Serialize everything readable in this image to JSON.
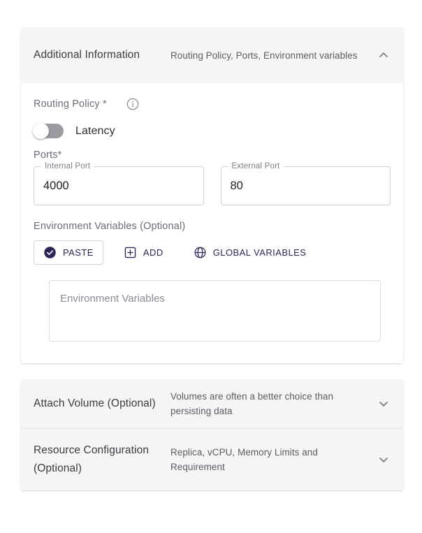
{
  "panels": {
    "additional": {
      "title": "Additional Information",
      "subtitle": "Routing Policy, Ports, Environment variables",
      "expand_icon": "chevron-up-icon"
    },
    "attach_volume": {
      "title": "Attach Volume (Optional)",
      "subtitle": "Volumes are often a better choice than persisting data",
      "expand_icon": "chevron-down-icon"
    },
    "resource_configuration": {
      "title": "Resource Configuration (Optional)",
      "subtitle": "Replica, vCPU, Memory Limits and Requirement",
      "expand_icon": "chevron-down-icon"
    }
  },
  "routing_policy": {
    "label": "Routing Policy *",
    "info_icon": "info-circle-icon",
    "switch": {
      "label": "Latency",
      "state": "off"
    }
  },
  "ports": {
    "label": "Ports*",
    "internal": {
      "label": "Internal Port",
      "value": "4000",
      "placeholder": "Internal Port"
    },
    "external": {
      "label": "External Port",
      "value": "80",
      "placeholder": "External Port"
    }
  },
  "environment_variables": {
    "label": "Environment Variables (Optional)",
    "buttons": [
      {
        "label": "PASTE",
        "icon": "check-circle-filled-icon",
        "selected": true
      },
      {
        "label": "ADD",
        "icon": "plus-square-icon",
        "selected": false
      },
      {
        "label": "GLOBAL VARIABLES",
        "icon": "globe-icon",
        "selected": false
      }
    ],
    "textarea": {
      "placeholder": "Environment Variables",
      "value": ""
    }
  },
  "colors": {
    "accent": "#2d2457",
    "header_bg": "#f5f5f5",
    "body_bg": "#ffffff",
    "label_text": "#6d6d77",
    "border": "#d0d0d4"
  }
}
